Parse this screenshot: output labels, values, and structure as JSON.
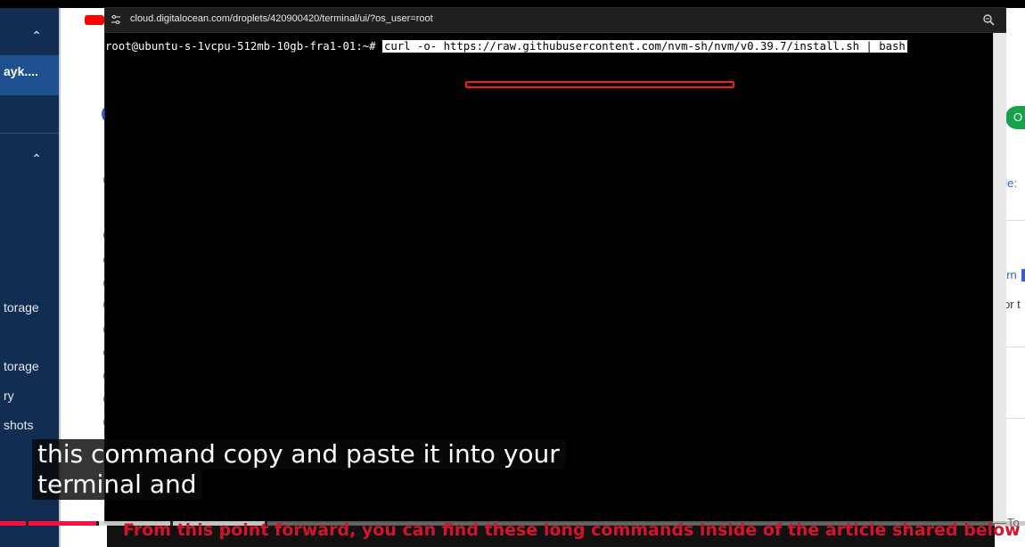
{
  "sidebar": {
    "active_item": "ayk....",
    "items": [
      {
        "label": "torage"
      },
      {
        "label": "torage"
      },
      {
        "label": "ry"
      },
      {
        "label": "shots"
      }
    ]
  },
  "popup": {
    "url": "cloud.digitalocean.com/droplets/420900420/terminal/ui/?os_user=root"
  },
  "terminal": {
    "prompt": "root@ubuntu-s-1vcpu-512mb-10gb-fra1-01:~# ",
    "command": "curl -o- https://raw.githubusercontent.com/nvm-sh/nvm/v0.39.7/install.sh | bash"
  },
  "right_page": {
    "button_label": "O",
    "text_1": "ole:",
    "text_2": "arn",
    "text_3": "or t",
    "text_4": "To"
  },
  "captions": {
    "line1": "this command copy and paste it into your",
    "line2": "terminal and"
  },
  "video": {
    "progress_fraction": 0.094,
    "buffer_fraction": 0.26
  },
  "overlay_note": "From this point forward, you can find these long commands inside of the article shared below",
  "colors": {
    "sidebar_bg": "#122d52",
    "sidebar_active": "#1e4f8f",
    "highlight_red": "#ff1a1a",
    "note_red": "#d4142b",
    "progress_red": "#ff0f3f"
  }
}
